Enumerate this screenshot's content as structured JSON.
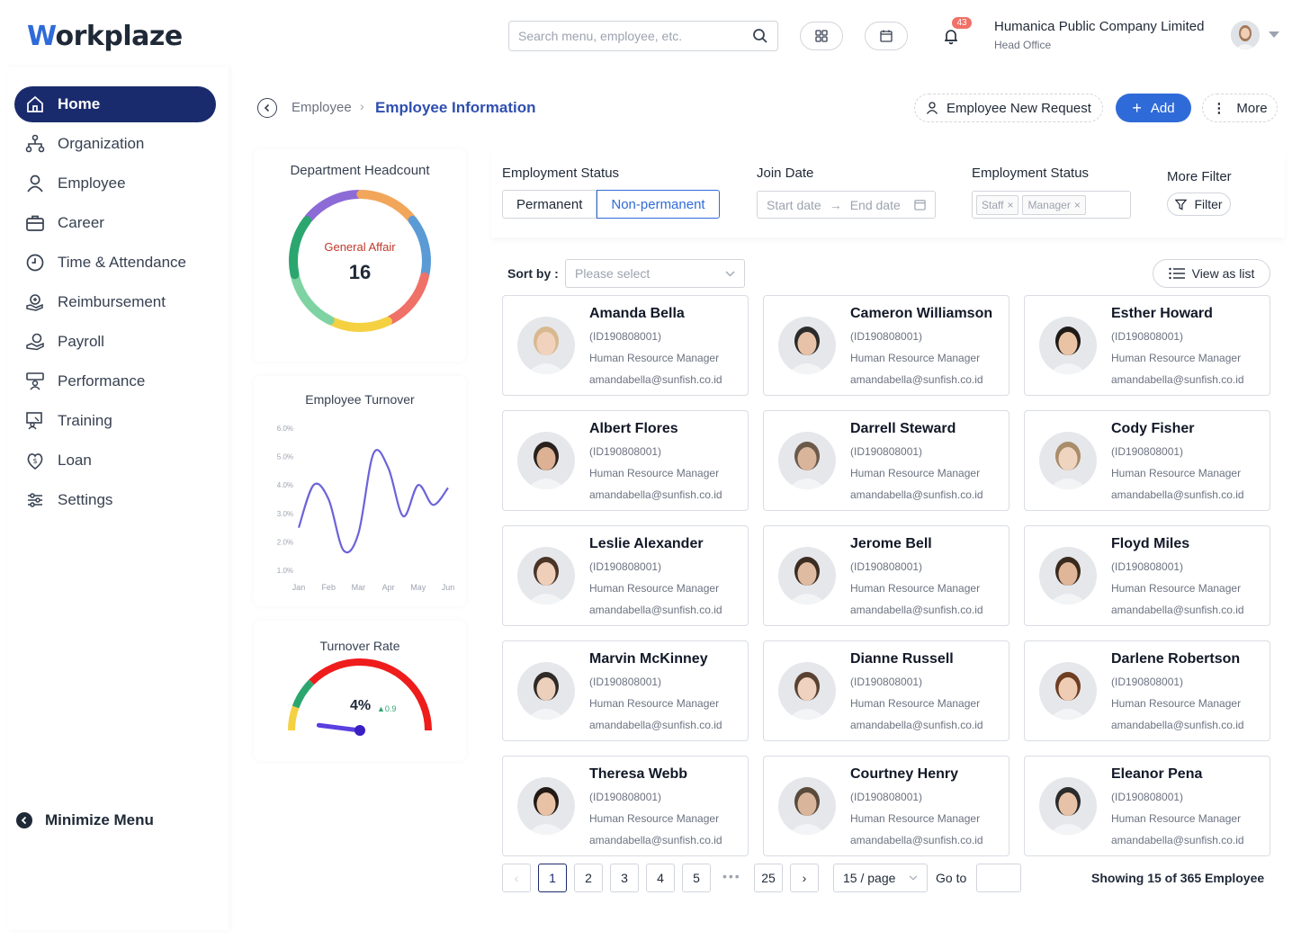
{
  "header": {
    "logo_w": "W",
    "logo_rest": "orkplaze",
    "search_placeholder": "Search menu, employee, etc.",
    "notification_count": "43",
    "company_name": "Humanica Public Company Limited",
    "company_branch": "Head Office"
  },
  "sidebar": {
    "items": [
      {
        "label": "Home",
        "icon": "home-icon"
      },
      {
        "label": "Organization",
        "icon": "organization-icon"
      },
      {
        "label": "Employee",
        "icon": "user-icon"
      },
      {
        "label": "Career",
        "icon": "briefcase-icon"
      },
      {
        "label": "Time & Attendance",
        "icon": "clock-icon"
      },
      {
        "label": "Reimbursement",
        "icon": "reimbursement-icon"
      },
      {
        "label": "Payroll",
        "icon": "payroll-icon"
      },
      {
        "label": "Performance",
        "icon": "performance-icon"
      },
      {
        "label": "Training",
        "icon": "training-icon"
      },
      {
        "label": "Loan",
        "icon": "loan-icon"
      },
      {
        "label": "Settings",
        "icon": "settings-icon"
      }
    ],
    "minimize_label": "Minimize Menu"
  },
  "breadcrumb": {
    "parent": "Employee",
    "current": "Employee Information",
    "new_request_label": "Employee New Request",
    "add_label": "Add",
    "more_label": "More"
  },
  "headcount": {
    "title": "Department Headcount",
    "department": "General Affair",
    "value": "16",
    "segment_colors": [
      "#8c6bd6",
      "#f2a65a",
      "#5b9bd5",
      "#f07167",
      "#f5d142",
      "#7fd3a2",
      "#2ca66f"
    ]
  },
  "turnover_chart": {
    "chart_data": {
      "type": "line",
      "title": "Employee Turnover",
      "categories": [
        "Jan",
        "Feb",
        "Mar",
        "Apr",
        "May",
        "Jun"
      ],
      "y_ticks": [
        "6.0%",
        "5.0%",
        "4.0%",
        "3.0%",
        "2.0%",
        "1.0%"
      ],
      "ylim": [
        1.0,
        6.0
      ],
      "x": [
        0,
        0.5,
        1.0,
        1.5,
        2.0,
        2.5,
        3.0,
        3.5,
        4.0,
        4.5,
        5.0
      ],
      "values": [
        2.5,
        4.0,
        3.5,
        1.7,
        2.3,
        5.1,
        4.6,
        2.9,
        4.0,
        3.3,
        3.9
      ],
      "color": "#6c63d9"
    }
  },
  "turnover_rate": {
    "title": "Turnover Rate",
    "value": "4%",
    "delta": "0.9",
    "gauge_fraction": 0.04
  },
  "filters": {
    "status_label": "Employment Status",
    "status_options": [
      "Permanent",
      "Non-permanent"
    ],
    "join_label": "Join Date",
    "start_placeholder": "Start date",
    "end_placeholder": "End date",
    "status2_label": "Employment Status",
    "tags": [
      "Staff",
      "Manager"
    ],
    "more_label": "More Filter",
    "filter_button": "Filter"
  },
  "sort": {
    "label": "Sort by :",
    "placeholder": "Please select",
    "view_label": "View as list"
  },
  "employees": [
    {
      "name": "Amanda Bella",
      "id": "(ID190808001)",
      "position": "Human Resource Manager",
      "email": "amandabella@sunfish.co.id",
      "skin": "#f1d3bd",
      "hair": "#d8b98f"
    },
    {
      "name": "Cameron Williamson",
      "id": "(ID190808001)",
      "position": "Human Resource Manager",
      "email": "amandabella@sunfish.co.id",
      "skin": "#e7c2a8",
      "hair": "#2b2b2b"
    },
    {
      "name": "Esther Howard",
      "id": "(ID190808001)",
      "position": "Human Resource Manager",
      "email": "amandabella@sunfish.co.id",
      "skin": "#e9c3a3",
      "hair": "#1f1a17"
    },
    {
      "name": "Albert Flores",
      "id": "(ID190808001)",
      "position": "Human Resource Manager",
      "email": "amandabella@sunfish.co.id",
      "skin": "#dcb194",
      "hair": "#2a211c"
    },
    {
      "name": "Darrell Steward",
      "id": "(ID190808001)",
      "position": "Human Resource Manager",
      "email": "amandabella@sunfish.co.id",
      "skin": "#d8b59b",
      "hair": "#6b5a4a"
    },
    {
      "name": "Cody Fisher",
      "id": "(ID190808001)",
      "position": "Human Resource Manager",
      "email": "amandabella@sunfish.co.id",
      "skin": "#efd4c0",
      "hair": "#a98c6a"
    },
    {
      "name": "Leslie Alexander",
      "id": "(ID190808001)",
      "position": "Human Resource Manager",
      "email": "amandabella@sunfish.co.id",
      "skin": "#efcfba",
      "hair": "#4a3426"
    },
    {
      "name": "Jerome Bell",
      "id": "(ID190808001)",
      "position": "Human Resource Manager",
      "email": "amandabella@sunfish.co.id",
      "skin": "#dfbba1",
      "hair": "#3c2d22"
    },
    {
      "name": "Floyd Miles",
      "id": "(ID190808001)",
      "position": "Human Resource Manager",
      "email": "amandabella@sunfish.co.id",
      "skin": "#e0b698",
      "hair": "#3a2a1e"
    },
    {
      "name": "Marvin McKinney",
      "id": "(ID190808001)",
      "position": "Human Resource Manager",
      "email": "amandabella@sunfish.co.id",
      "skin": "#ecd0bc",
      "hair": "#2f2a26"
    },
    {
      "name": "Dianne Russell",
      "id": "(ID190808001)",
      "position": "Human Resource Manager",
      "email": "amandabella@sunfish.co.id",
      "skin": "#efd3c0",
      "hair": "#5a4232"
    },
    {
      "name": "Darlene Robertson",
      "id": "(ID190808001)",
      "position": "Human Resource Manager",
      "email": "amandabella@sunfish.co.id",
      "skin": "#efcdb5",
      "hair": "#6e3e22"
    },
    {
      "name": "Theresa Webb",
      "id": "(ID190808001)",
      "position": "Human Resource Manager",
      "email": "amandabella@sunfish.co.id",
      "skin": "#e9c2a6",
      "hair": "#231a15"
    },
    {
      "name": "Courtney Henry",
      "id": "(ID190808001)",
      "position": "Human Resource Manager",
      "email": "amandabella@sunfish.co.id",
      "skin": "#d8b59b",
      "hair": "#5a4a3c"
    },
    {
      "name": "Eleanor Pena",
      "id": "(ID190808001)",
      "position": "Human Resource Manager",
      "email": "amandabella@sunfish.co.id",
      "skin": "#e7c2a8",
      "hair": "#2b2b2b"
    }
  ],
  "pagination": {
    "pages": [
      "1",
      "2",
      "3",
      "4",
      "5"
    ],
    "last_page": "25",
    "dots": "•••",
    "page_size": "15 / page",
    "goto_label": "Go to",
    "showing": "Showing 15 of 365 Employee"
  }
}
